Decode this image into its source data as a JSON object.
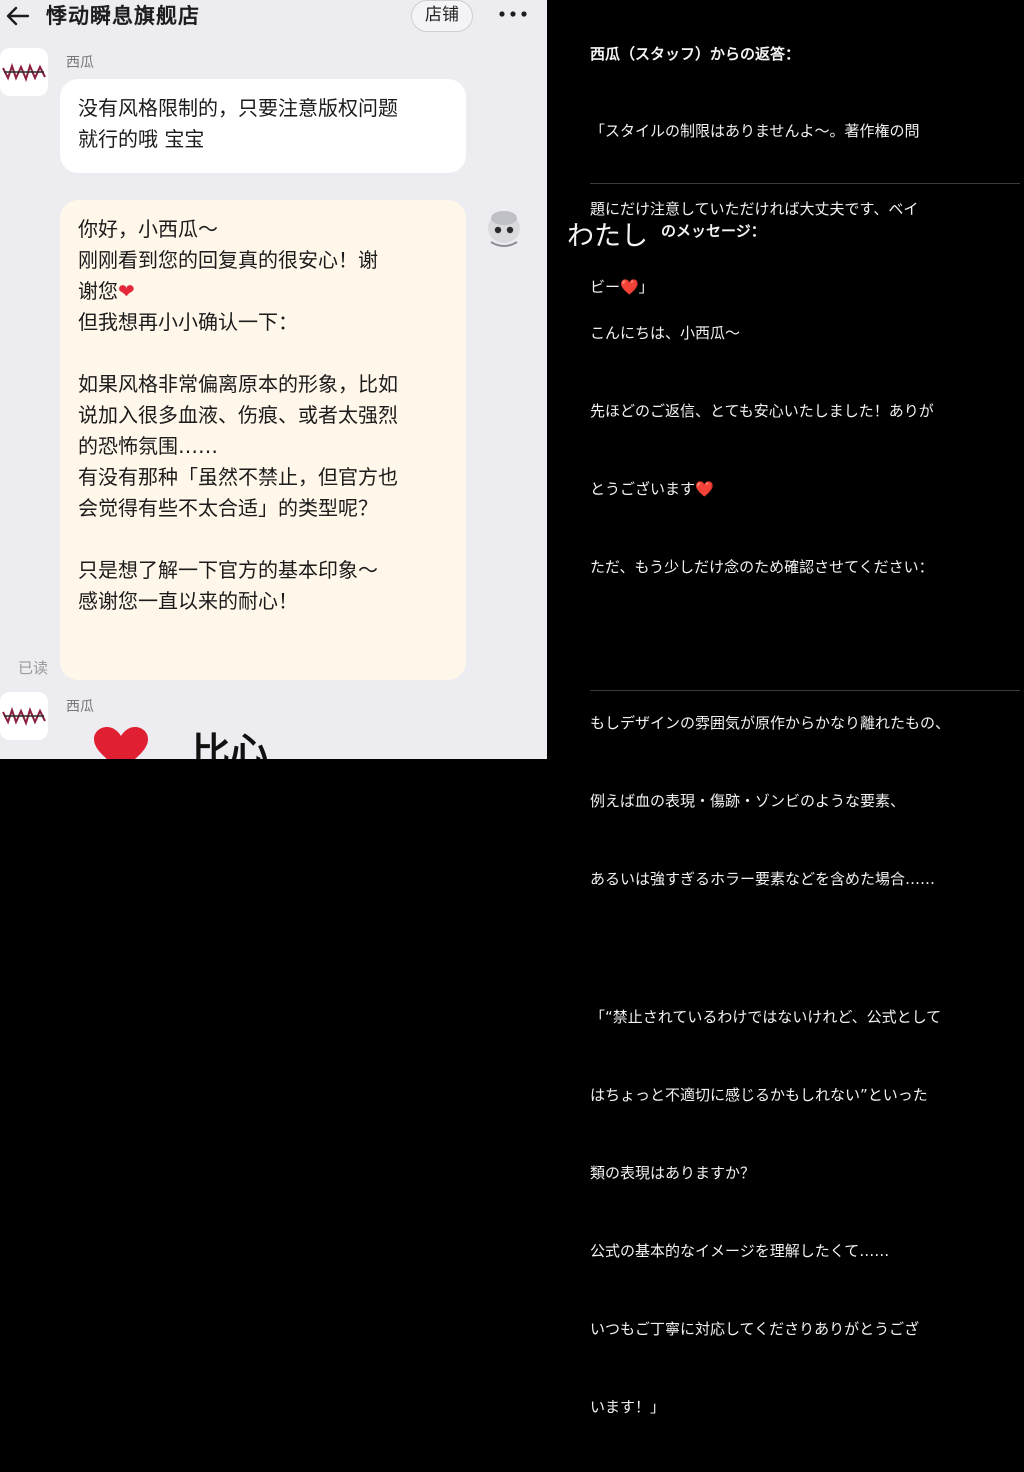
{
  "chat": {
    "shop_title": "悸动瞬息旗舰店",
    "store_button": "店铺",
    "sender_name": "西瓜",
    "sender_name_2": "西瓜",
    "reply_lines": [
      "没有风格限制的，只要注意版权问题",
      "就行的哦 宝宝"
    ],
    "my_lines": [
      "你好，小西瓜～",
      "刚刚看到您的回复真的很安心！谢",
      "谢您",
      "但我想再小小确认一下：",
      "",
      "如果风格非常偏离原本的形象，比如",
      "说加入很多血液、伤痕、或者太强烈",
      "的恐怖氛围……",
      "有没有那种「虽然不禁止，但官方也",
      "会觉得有些不太合适」的类型呢？",
      "",
      "只是想了解一下官方的基本印象～",
      "感谢您一直以来的耐心！"
    ],
    "read_status": "已读",
    "partial_text": "比心"
  },
  "translation": {
    "reply_header": "西瓜（スタッフ）からの返答：",
    "reply_lines": [
      "「スタイルの制限はありませんよ〜。著作権の問",
      "題にだけ注意していただければ大丈夫です、ベイ",
      "ビー❤️」"
    ],
    "me_label": "わたし",
    "me_suffix": "のメッセージ：",
    "message_lines": [
      "こんにちは、小西瓜〜",
      "先ほどのご返信、とても安心いたしました！ありが",
      "とうございます❤️",
      "ただ、もう少しだけ念のため確認させてください：",
      "",
      "もしデザインの雰囲気が原作からかなり離れたもの、",
      "例えば血の表現・傷跡・ゾンビのような要素、",
      "あるいは強すぎるホラー要素などを含めた場合……",
      "",
      "「“禁止されているわけではないけれど、公式として",
      "はちょっと不適切に感じるかもしれない”といった",
      "類の表現はありますか？",
      "公式の基本的なイメージを理解したくて……",
      "いつもご丁寧に対応してくださりありがとうござ",
      "います！」"
    ]
  },
  "colors": {
    "chat_bg": "#ececf1",
    "incoming_bubble": "#ffffff",
    "outgoing_bubble": "#fff7ea",
    "heart": "#e4283a",
    "translation_bg": "#000000"
  }
}
